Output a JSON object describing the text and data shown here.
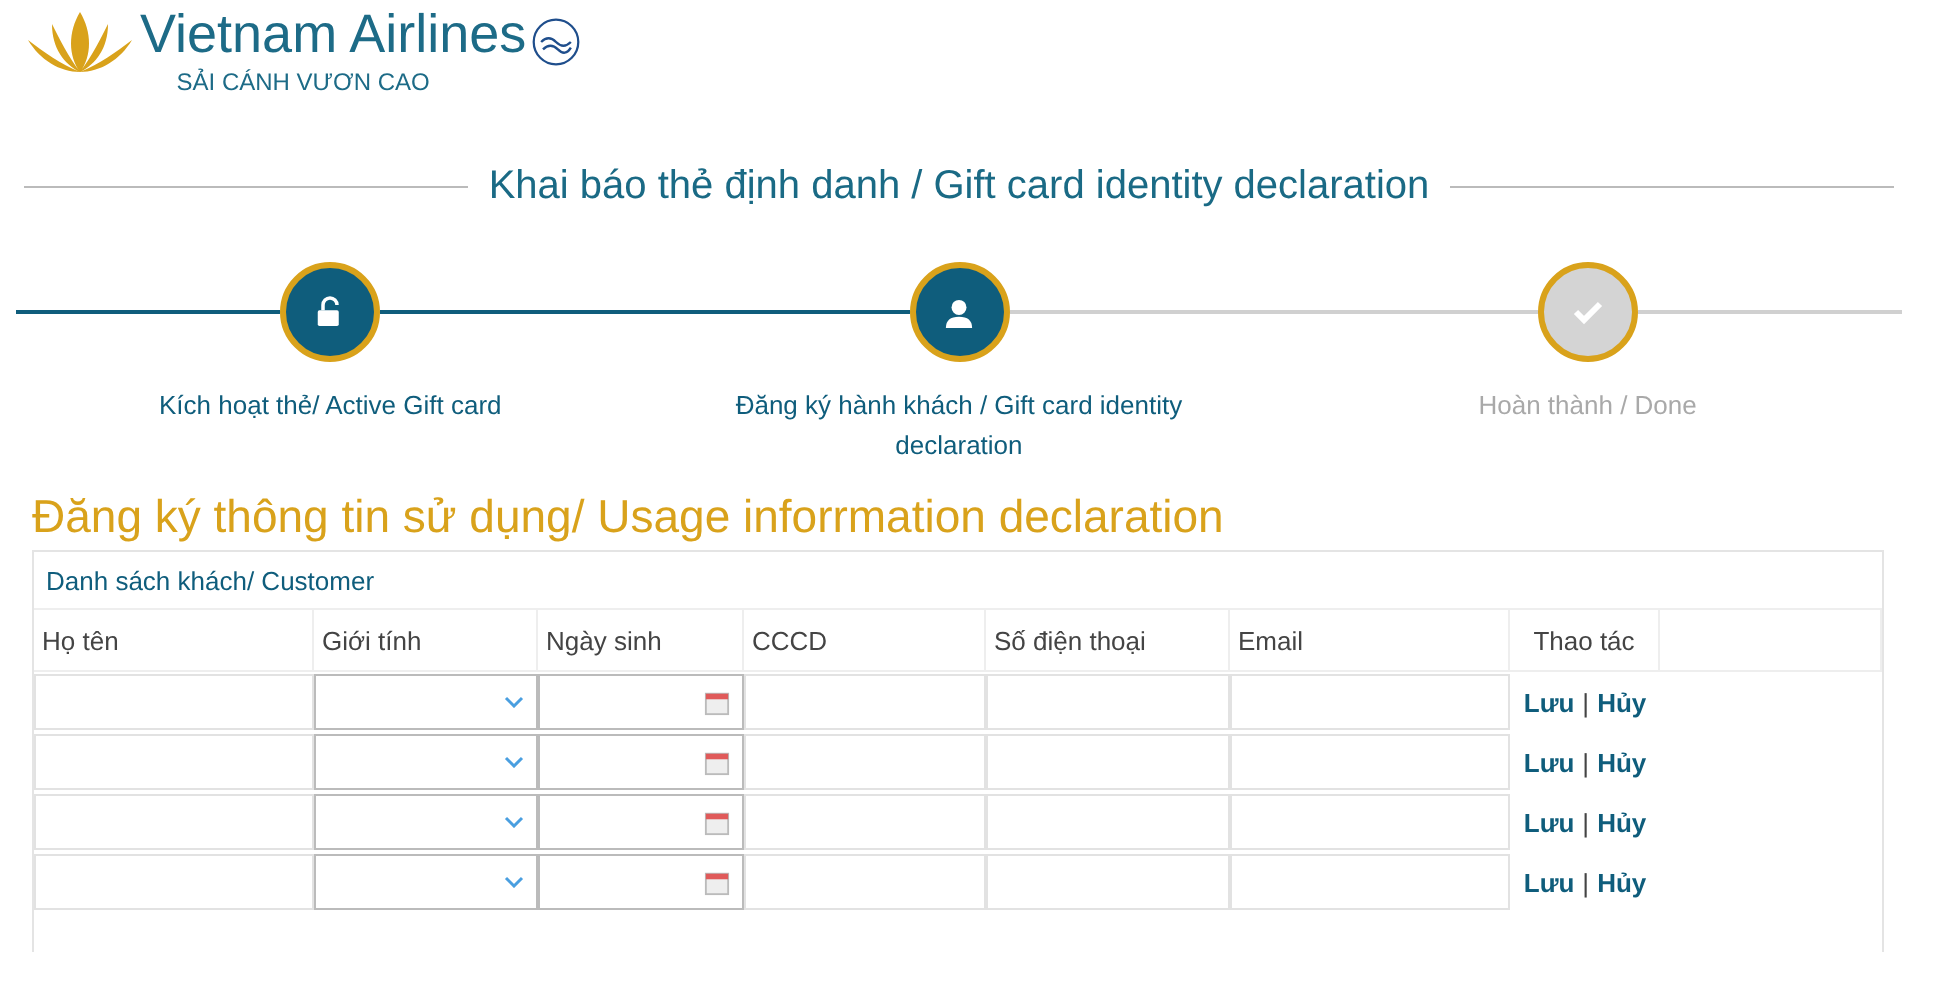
{
  "logo": {
    "name": "Vietnam Airlines",
    "slogan": "SẢI CÁNH VƯƠN CAO"
  },
  "title": "Khai báo thẻ định danh / Gift card identity declaration",
  "steps": [
    {
      "kind": "unlock",
      "label": "Kích hoạt thẻ/ Active Gift card",
      "completed": true
    },
    {
      "kind": "user",
      "label": "Đăng ký hành khách / Gift card identity declaration",
      "completed": true
    },
    {
      "kind": "check",
      "label": "Hoàn thành / Done",
      "completed": false
    }
  ],
  "section_title": "Đăng ký thông tin sử dụng/ Usage inforrmation declaration",
  "table": {
    "caption": "Danh sách khách/ Customer",
    "columns": [
      "Họ tên",
      "Giới tính",
      "Ngày sinh",
      "CCCD",
      "Số điện thoại",
      "Email",
      "Thao tác"
    ],
    "rows": [
      {
        "save": "Lưu",
        "separator": "|",
        "cancel": "Hủy"
      },
      {
        "save": "Lưu",
        "separator": "|",
        "cancel": "Hủy"
      },
      {
        "save": "Lưu",
        "separator": "|",
        "cancel": "Hủy"
      },
      {
        "save": "Lưu",
        "separator": "|",
        "cancel": "Hủy"
      }
    ]
  }
}
